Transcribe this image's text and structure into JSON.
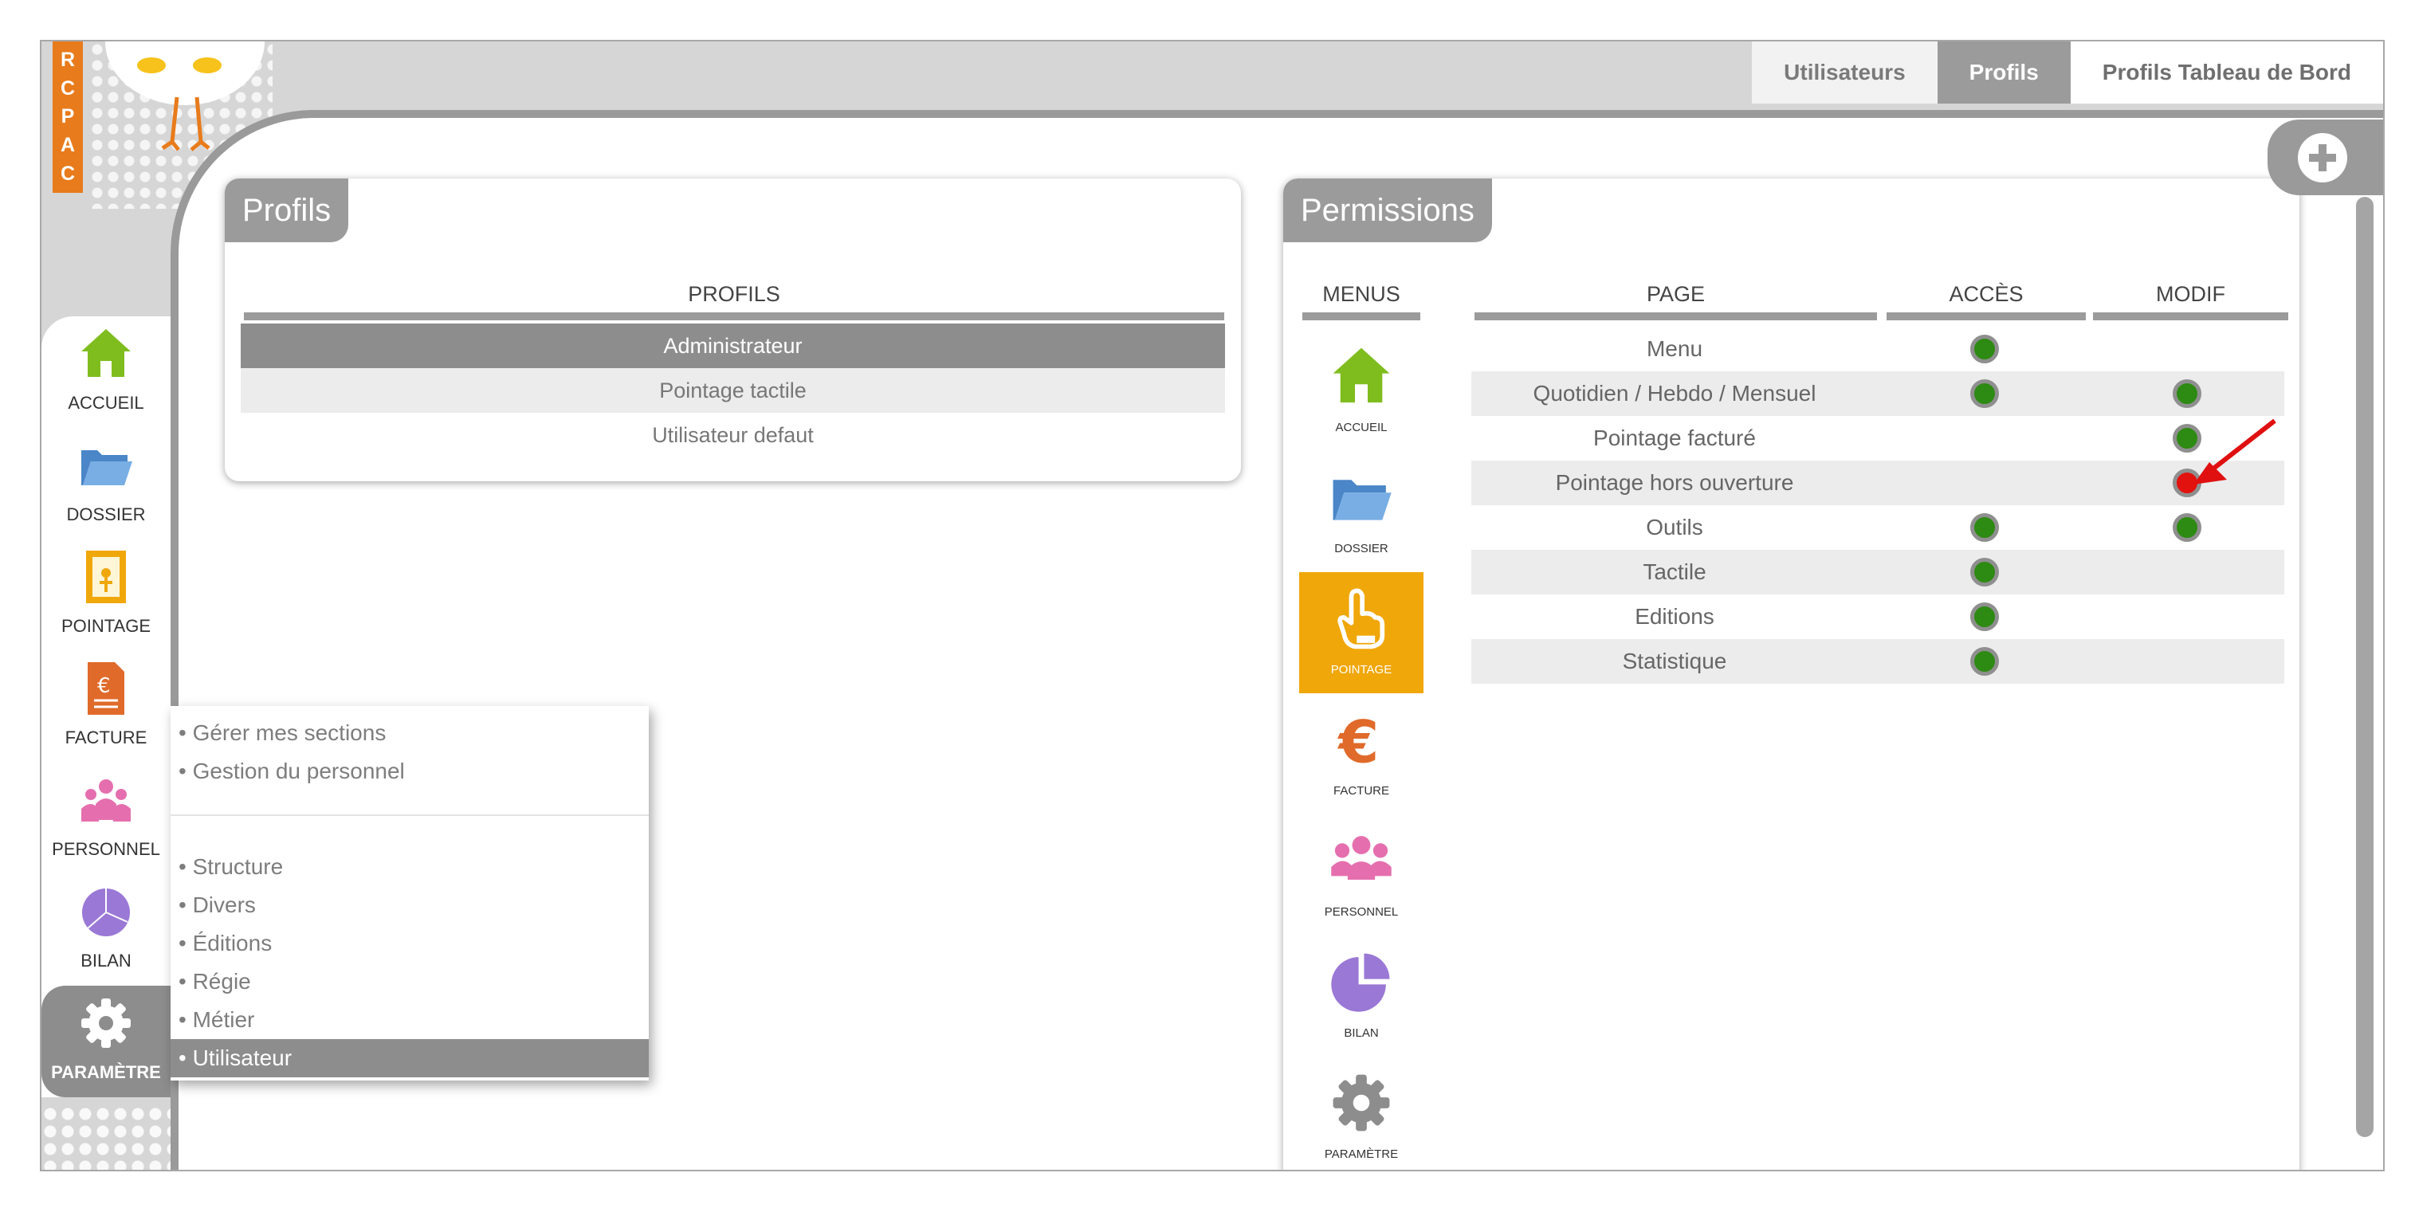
{
  "brand": {
    "letters": [
      "C",
      "A",
      "P",
      "C",
      "R"
    ]
  },
  "tabs": [
    {
      "label": "Utilisateurs",
      "active": false
    },
    {
      "label": "Profils",
      "active": true
    },
    {
      "label": "Profils Tableau de Bord",
      "active": false
    }
  ],
  "nav": {
    "items": [
      {
        "label": "ACCUEIL",
        "icon": "home-icon"
      },
      {
        "label": "DOSSIER",
        "icon": "folder-icon"
      },
      {
        "label": "POINTAGE",
        "icon": "door-icon"
      },
      {
        "label": "FACTURE",
        "icon": "invoice-icon"
      },
      {
        "label": "PERSONNEL",
        "icon": "people-icon"
      },
      {
        "label": "BILAN",
        "icon": "pie-chart-icon"
      },
      {
        "label": "PARAMÈTRE",
        "icon": "gear-icon",
        "active": true
      }
    ]
  },
  "submenu": {
    "group1": [
      "• Gérer mes sections",
      "• Gestion du personnel"
    ],
    "group2": [
      "• Structure",
      "• Divers",
      "• Éditions",
      "• Régie",
      "• Métier",
      "• Utilisateur"
    ],
    "active": "• Utilisateur"
  },
  "profils": {
    "title": "Profils",
    "header": "PROFILS",
    "rows": [
      {
        "label": "Administrateur",
        "selected": true
      },
      {
        "label": "Pointage tactile",
        "selected": false
      },
      {
        "label": "Utilisateur defaut",
        "selected": false
      }
    ]
  },
  "permissions": {
    "title": "Permissions",
    "headers": {
      "menus": "MENUS",
      "page": "PAGE",
      "acces": "ACCÈS",
      "modif": "MODIF"
    },
    "menus": [
      {
        "label": "ACCUEIL",
        "icon": "home-icon"
      },
      {
        "label": "DOSSIER",
        "icon": "folder-icon"
      },
      {
        "label": "POINTAGE",
        "icon": "pointing-hand-icon",
        "active": true
      },
      {
        "label": "FACTURE",
        "icon": "euro-icon"
      },
      {
        "label": "PERSONNEL",
        "icon": "people-icon"
      },
      {
        "label": "BILAN",
        "icon": "pie-chart-icon"
      },
      {
        "label": "PARAMÈTRE",
        "icon": "gear-icon"
      }
    ],
    "pages": [
      {
        "name": "Menu",
        "acces": "green",
        "modif": null
      },
      {
        "name": "Quotidien / Hebdo / Mensuel",
        "acces": "green",
        "modif": "green"
      },
      {
        "name": "Pointage facturé",
        "acces": null,
        "modif": "green"
      },
      {
        "name": "Pointage hors ouverture",
        "acces": null,
        "modif": "red"
      },
      {
        "name": "Outils",
        "acces": "green",
        "modif": "green"
      },
      {
        "name": "Tactile",
        "acces": "green",
        "modif": null
      },
      {
        "name": "Editions",
        "acces": "green",
        "modif": null
      },
      {
        "name": "Statistique",
        "acces": "green",
        "modif": null
      }
    ]
  },
  "colors": {
    "accent_orange": "#e87b1b",
    "pointage_yellow": "#f0a70a",
    "status_green": "#2d8a12",
    "status_red": "#e2120e",
    "arrow_red": "#e01010",
    "header_gray": "#9b9b9b"
  }
}
